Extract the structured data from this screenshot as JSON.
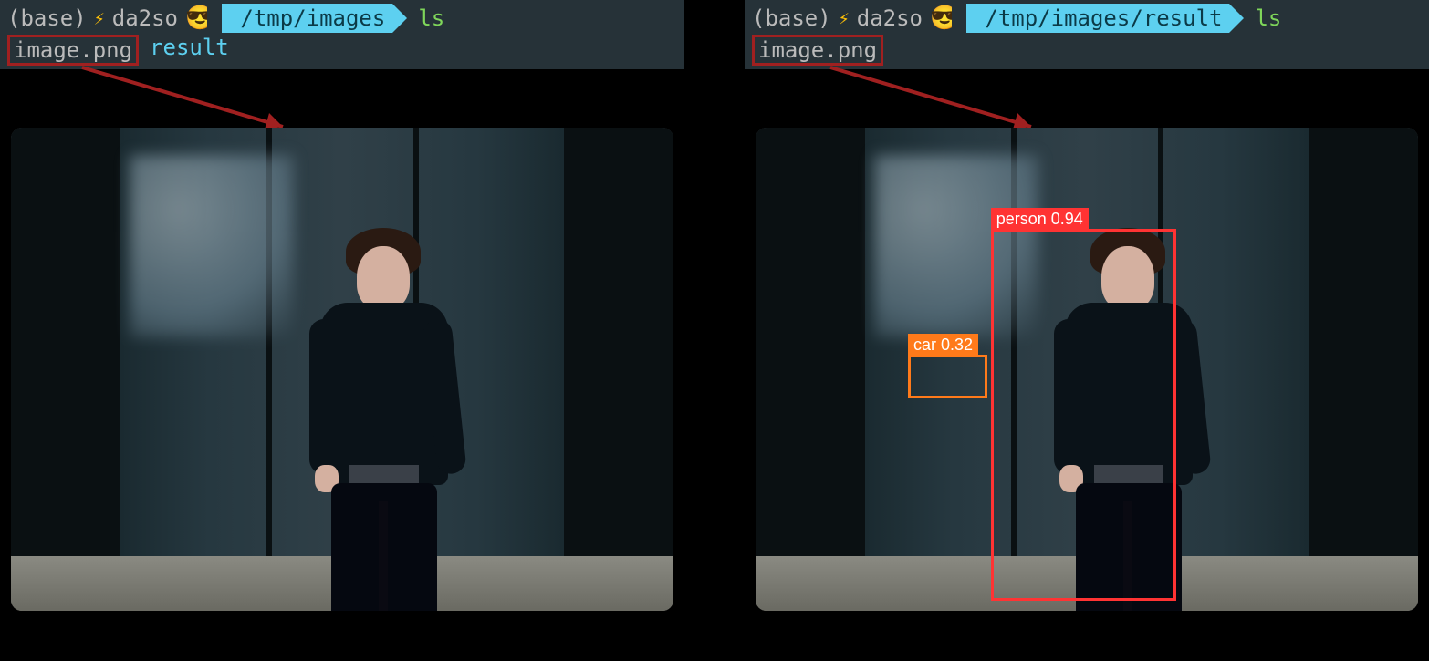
{
  "left_terminal": {
    "env": "(base)",
    "user": "da2so",
    "emoji": "😎",
    "path": "/tmp/images",
    "cmd": "ls",
    "output_file": "image.png",
    "output_folder": "result"
  },
  "right_terminal": {
    "env": "(base)",
    "user": "da2so",
    "emoji": "😎",
    "path": "/tmp/images/result",
    "cmd": "ls",
    "output_file": "image.png"
  },
  "detections": {
    "person": {
      "label": "person 0.94"
    },
    "car": {
      "label": "car 0.32"
    }
  }
}
